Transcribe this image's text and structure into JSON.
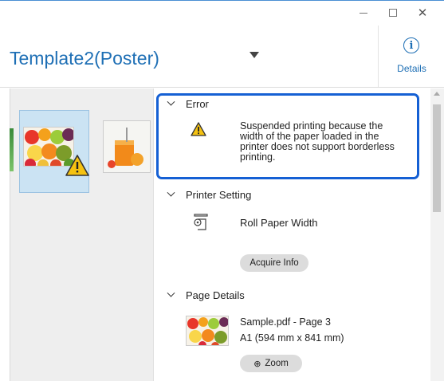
{
  "window": {
    "controls": {
      "minimize": "minimize",
      "maximize": "maximize",
      "close": "close"
    }
  },
  "header": {
    "title": "Template2(Poster)",
    "details_label": "Details",
    "details_icon": "info-icon"
  },
  "details": {
    "error": {
      "heading": "Error",
      "message": "Suspended printing because the width of the paper loaded in the printer does not support borderless printing.",
      "highlight_color": "#1560d4"
    },
    "printer_setting": {
      "heading": "Printer Setting",
      "item_label": "Roll Paper Width",
      "acquire_button": "Acquire Info"
    },
    "page_details": {
      "heading": "Page Details",
      "file_name": "Sample.pdf - Page 3",
      "paper_size": "A1 (594 mm x 841 mm)",
      "zoom_button": "Zoom"
    }
  },
  "colors": {
    "accent": "#1e6fb5",
    "warning_fill": "#f5c211",
    "selection": "#cbe3f3"
  }
}
